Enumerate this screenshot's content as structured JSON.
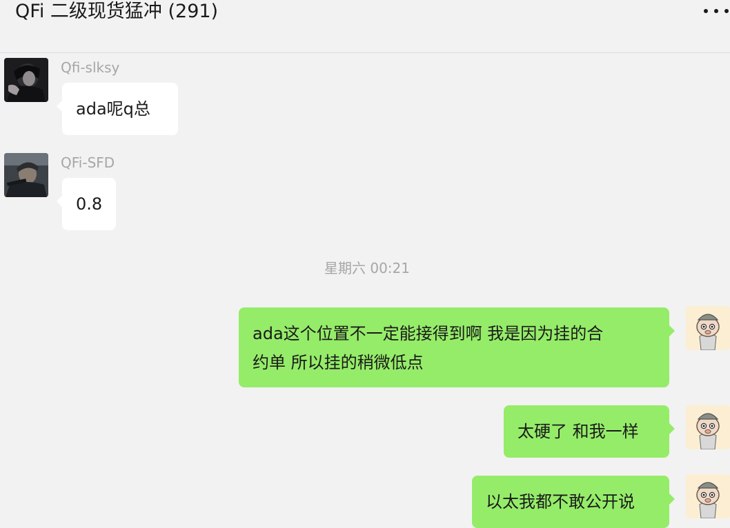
{
  "header": {
    "title": "QFi 二级现货猛冲 (291)",
    "more_icon": "more-dots-icon"
  },
  "messages": [
    {
      "sender": "Qfi-slksy",
      "text": "ada呢q总",
      "direction": "incoming",
      "avatar_icon": "user-avatar-dark-portrait"
    },
    {
      "sender": "QFi-SFD",
      "text": "0.8",
      "direction": "incoming",
      "avatar_icon": "user-avatar-soldier-portrait"
    }
  ],
  "timestamp": "星期六 00:21",
  "outgoing": [
    {
      "line1": "ada这个位置不一定能接得到啊 我是因为挂的合",
      "line2": "约单 所以挂的稍微低点",
      "direction": "outgoing",
      "avatar_icon": "self-avatar-cartoon-pig"
    },
    {
      "text": "太硬了 和我一样",
      "direction": "outgoing",
      "avatar_icon": "self-avatar-cartoon-pig"
    },
    {
      "text": "以太我都不敢公开说",
      "direction": "outgoing",
      "avatar_icon": "self-avatar-cartoon-pig"
    }
  ],
  "colors": {
    "background": "#f2f2f2",
    "incoming_bubble": "#ffffff",
    "outgoing_bubble": "#95ec69",
    "meta_text": "#a6a6a6"
  }
}
